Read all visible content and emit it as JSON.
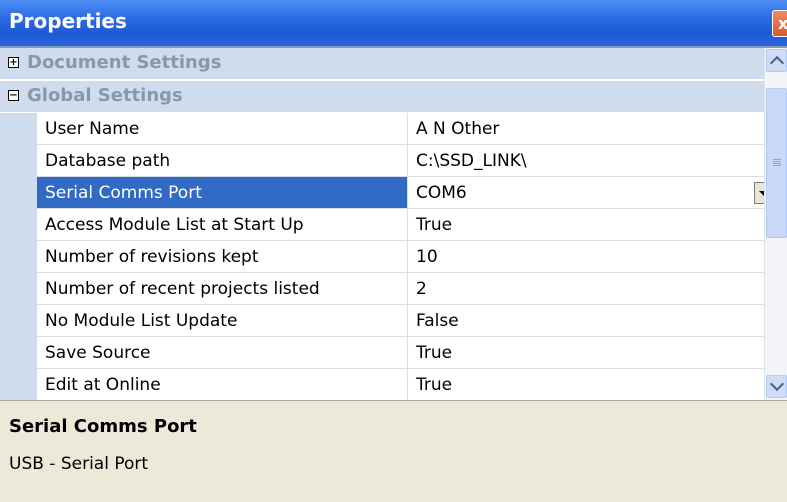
{
  "window": {
    "title": "Properties",
    "close_glyph": "x"
  },
  "categories": [
    {
      "label": "Document Settings",
      "expander": "+",
      "state": "collapsed"
    },
    {
      "label": "Global Settings",
      "expander": "−",
      "state": "expanded"
    }
  ],
  "properties": [
    {
      "name": "User Name",
      "value": "A N Other"
    },
    {
      "name": "Database path",
      "value": "C:\\SSD_LINK\\"
    },
    {
      "name": "Serial Comms Port",
      "value": "COM6"
    },
    {
      "name": "Access Module List at Start Up",
      "value": "True"
    },
    {
      "name": "Number of revisions kept",
      "value": "10"
    },
    {
      "name": "Number of recent projects listed",
      "value": "2"
    },
    {
      "name": "No Module List Update",
      "value": "False"
    },
    {
      "name": "Save Source",
      "value": "True"
    },
    {
      "name": "Edit at Online",
      "value": "True"
    }
  ],
  "selected_property": "Serial Comms Port",
  "help": {
    "title": "Serial Comms Port",
    "description": "USB - Serial Port"
  },
  "colors": {
    "titlebar": "#2f6fe6",
    "category_band": "#cfdcee",
    "selection": "#316ac5",
    "help_panel": "#ece9d8"
  },
  "icons": [
    "close-icon",
    "expand-icon",
    "collapse-icon",
    "dropdown-arrow-icon",
    "scroll-up-icon",
    "scroll-down-icon"
  ]
}
